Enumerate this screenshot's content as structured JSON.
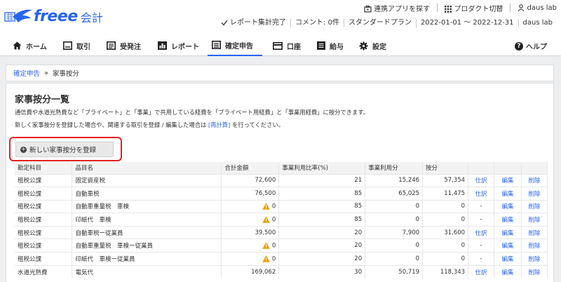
{
  "brand": {
    "name": "freee",
    "sub": "会計"
  },
  "top_links": {
    "apps": "連携アプリを探す",
    "switch": "プロダクト切替",
    "user": "daus lab"
  },
  "status": {
    "report": "レポート集計完了",
    "comments": "コメント: 0件",
    "plan": "スタンダードプラン",
    "period": "2022-01-01 ～ 2022-12-31",
    "company": "daus lab"
  },
  "nav": {
    "items": [
      "ホーム",
      "取引",
      "受発注",
      "レポート",
      "確定申告",
      "口座",
      "給与",
      "設定"
    ],
    "help": "ヘルプ"
  },
  "breadcrumb": {
    "parent": "確定申告",
    "sep": "»",
    "current": "家事按分"
  },
  "page": {
    "title": "家事按分一覧",
    "desc1": "通信費や水道光熱費など「プライベート」と「事業」で共用している経費を「プライベート用経費」と「事業用経費」に按分できます。",
    "desc2_pre": "新しく家事按分を登録した場合や、関連する取引を登録 / 編集した場合は",
    "desc2_link": "[再計算]",
    "desc2_post": "を行ってください。",
    "register_button": "新しい家事按分を登録"
  },
  "table": {
    "headers": [
      "勘定科目",
      "品目名",
      "合計金額",
      "事業利用比率(%)",
      "事業利用分",
      "按分",
      "",
      "",
      ""
    ],
    "rows": [
      {
        "account": "租税公課",
        "item": "固定資産税",
        "total": "72,600",
        "warn": false,
        "ratio": "21",
        "business": "15,246",
        "allocation": "57,354",
        "journal": "仕訳",
        "edit": "編集",
        "del": "削除"
      },
      {
        "account": "租税公課",
        "item": "自動車税",
        "total": "76,500",
        "warn": false,
        "ratio": "85",
        "business": "65,025",
        "allocation": "11,475",
        "journal": "仕訳",
        "edit": "編集",
        "del": "削除"
      },
      {
        "account": "租税公課",
        "item": "自動車重量税　車検",
        "total": "0",
        "warn": true,
        "ratio": "85",
        "business": "0",
        "allocation": "0",
        "journal": "-",
        "edit": "編集",
        "del": "削除"
      },
      {
        "account": "租税公課",
        "item": "印紙代　車検",
        "total": "0",
        "warn": true,
        "ratio": "85",
        "business": "0",
        "allocation": "0",
        "journal": "-",
        "edit": "編集",
        "del": "削除"
      },
      {
        "account": "租税公課",
        "item": "自動車税ー従業員",
        "total": "39,500",
        "warn": false,
        "ratio": "20",
        "business": "7,900",
        "allocation": "31,600",
        "journal": "仕訳",
        "edit": "編集",
        "del": "削除"
      },
      {
        "account": "租税公課",
        "item": "自動車重量税　車検ー従業員",
        "total": "0",
        "warn": true,
        "ratio": "20",
        "business": "0",
        "allocation": "0",
        "journal": "-",
        "edit": "編集",
        "del": "削除"
      },
      {
        "account": "租税公課",
        "item": "印紙代　車検ー従業員",
        "total": "0",
        "warn": true,
        "ratio": "20",
        "business": "0",
        "allocation": "0",
        "journal": "-",
        "edit": "編集",
        "del": "削除"
      },
      {
        "account": "水道光熱費",
        "item": "電気代",
        "total": "169,062",
        "warn": false,
        "ratio": "30",
        "business": "50,719",
        "allocation": "118,343",
        "journal": "仕訳",
        "edit": "編集",
        "del": "削除"
      }
    ]
  },
  "colors": {
    "accent": "#2864f0",
    "highlight": "#e32020",
    "warning": "#e8a000"
  }
}
